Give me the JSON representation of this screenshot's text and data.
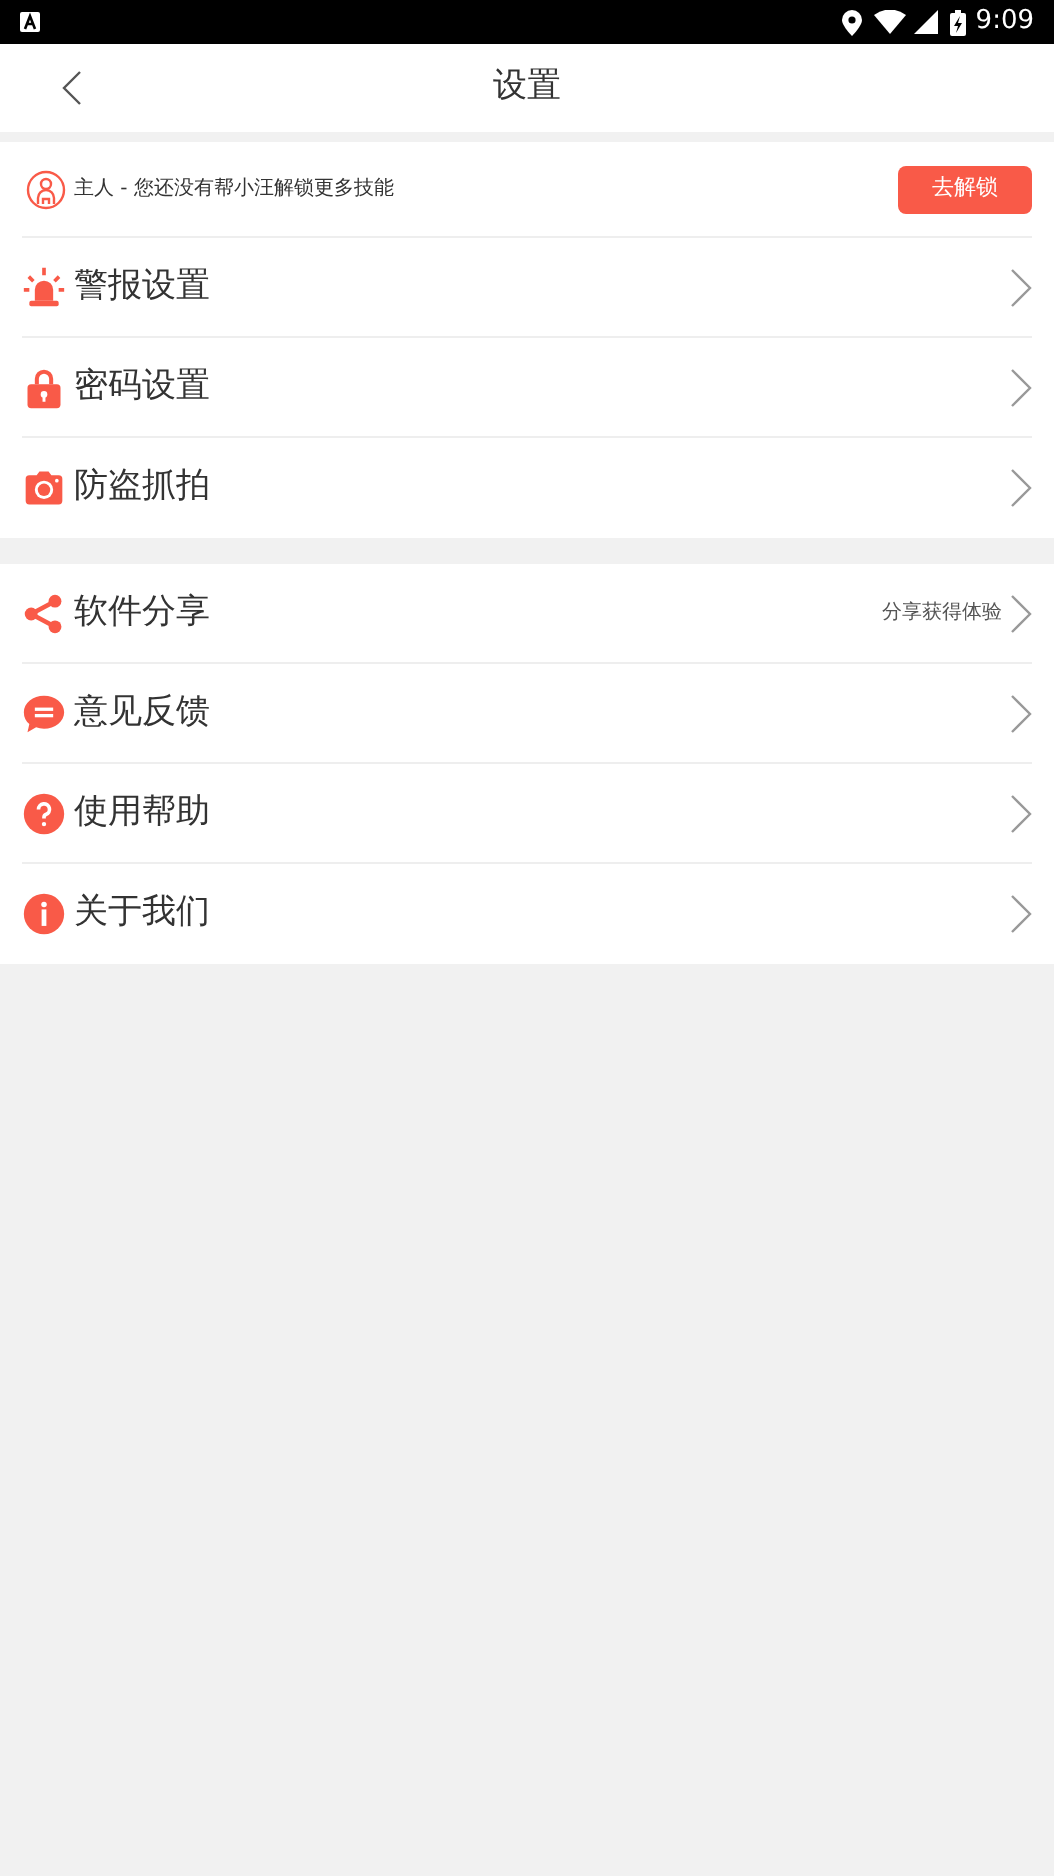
{
  "status_bar": {
    "time": "9:09"
  },
  "header": {
    "title": "设置"
  },
  "banner": {
    "text": "主人 - 您还没有帮小汪解锁更多技能",
    "button": "去解锁"
  },
  "sections": [
    {
      "items": [
        {
          "kind": "alarm",
          "label": "警报设置"
        },
        {
          "kind": "lock",
          "label": "密码设置"
        },
        {
          "kind": "camera",
          "label": "防盗抓拍"
        }
      ]
    },
    {
      "items": [
        {
          "kind": "share",
          "label": "软件分享",
          "note": "分享获得体验"
        },
        {
          "kind": "chat",
          "label": "意见反馈"
        },
        {
          "kind": "help",
          "label": "使用帮助"
        },
        {
          "kind": "info",
          "label": "关于我们"
        }
      ]
    }
  ]
}
